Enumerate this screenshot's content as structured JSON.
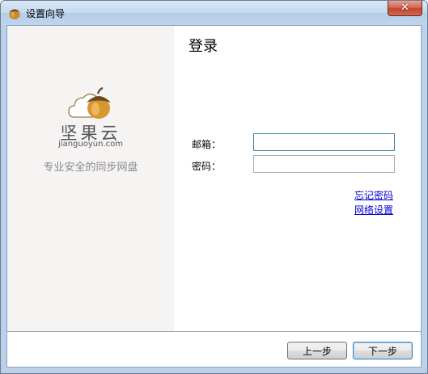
{
  "window": {
    "title": "设置向导"
  },
  "brand": {
    "name": "坚果云",
    "domain": "jianguoyun.com",
    "slogan": "专业安全的同步网盘"
  },
  "login": {
    "heading": "登录",
    "email_label": "邮箱：",
    "email_value": "",
    "password_label": "密码：",
    "password_value": "",
    "forgot_password_link": "忘记密码",
    "network_settings_link": "网络设置"
  },
  "footer": {
    "back_label": "上一步",
    "next_label": "下一步"
  },
  "colors": {
    "left_panel": "#f6f3f3",
    "link": "#0000cc",
    "close_button": "#c24630"
  }
}
